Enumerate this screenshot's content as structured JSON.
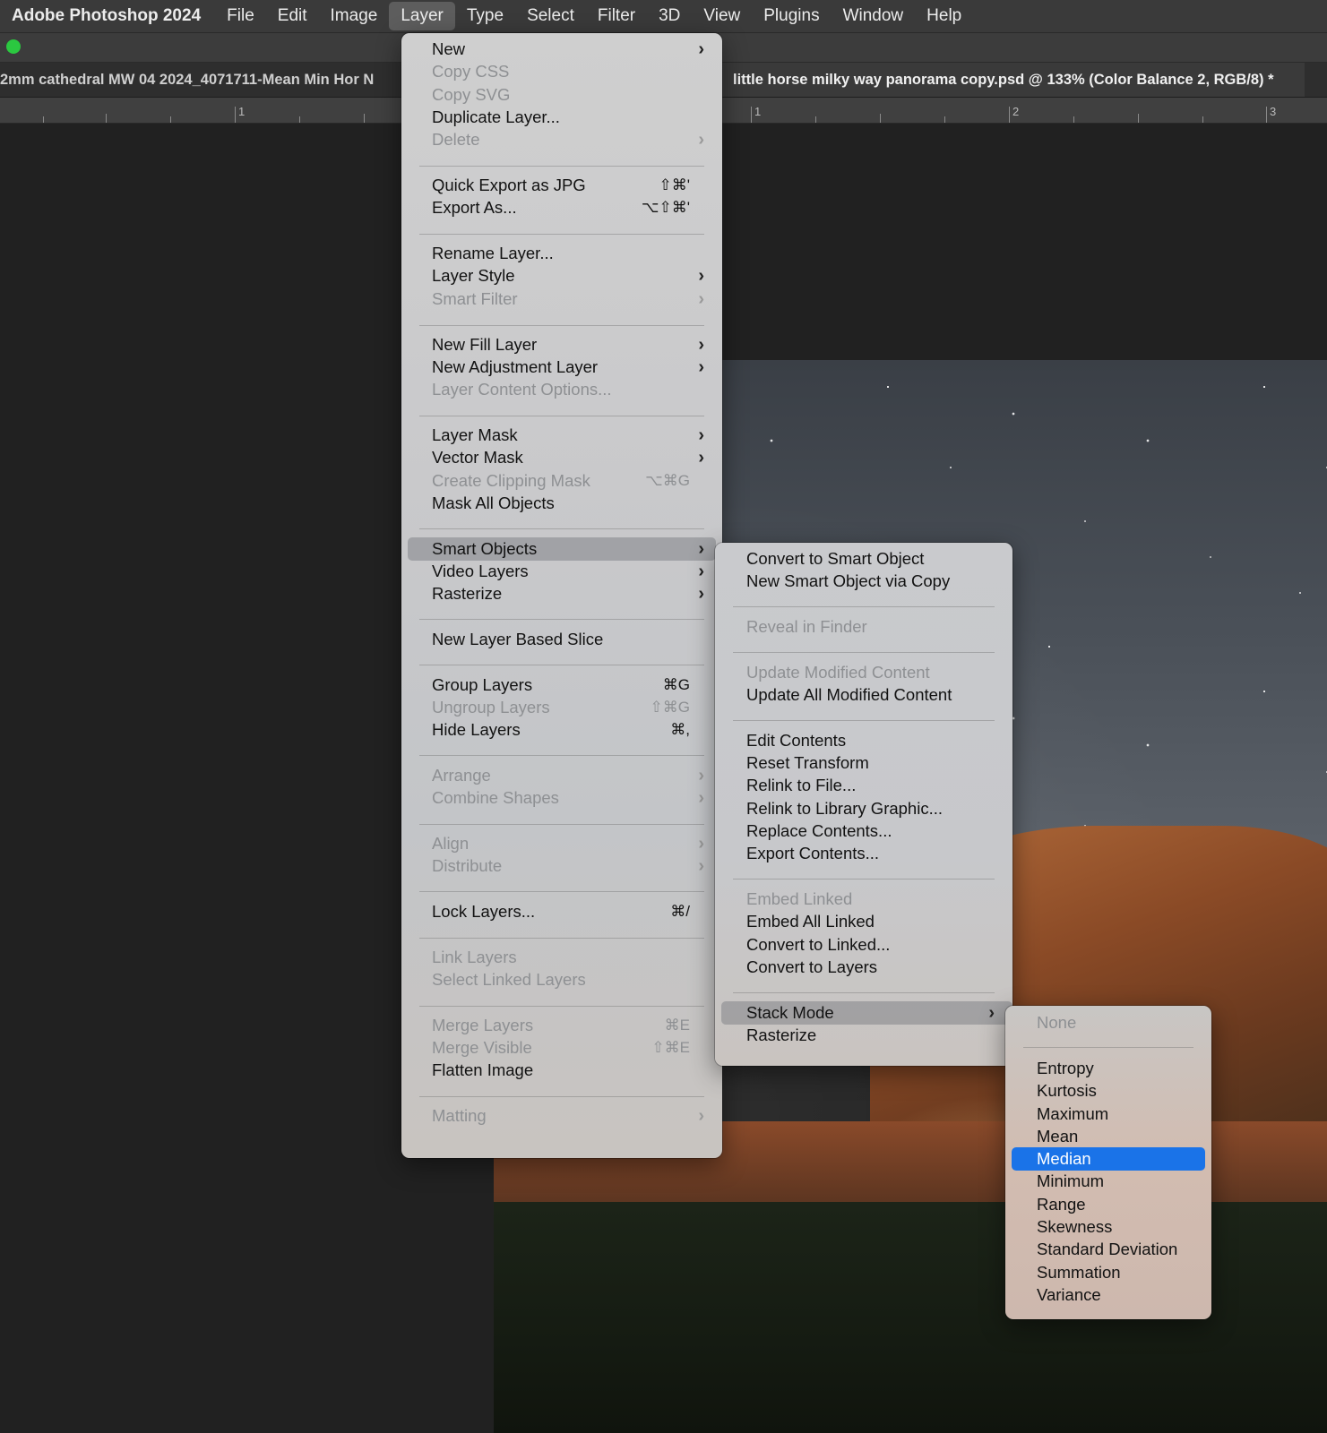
{
  "menubar": {
    "app_name": "Adobe Photoshop 2024",
    "items": [
      "File",
      "Edit",
      "Image",
      "Layer",
      "Type",
      "Select",
      "Filter",
      "3D",
      "View",
      "Plugins",
      "Window",
      "Help"
    ]
  },
  "tabs": {
    "inactive": "2mm cathedral MW 04 2024_4071711-Mean Min Hor N",
    "active": "little horse milky way panorama copy.psd @ 133% (Color Balance 2, RGB/8) *"
  },
  "ruler": {
    "marks": [
      "1",
      "1",
      "2",
      "3"
    ]
  },
  "layer_menu": {
    "items": [
      {
        "label": "New",
        "arrow": true
      },
      {
        "label": "Copy CSS",
        "disabled": true
      },
      {
        "label": "Copy SVG",
        "disabled": true
      },
      {
        "label": "Duplicate Layer..."
      },
      {
        "label": "Delete",
        "disabled": true,
        "arrow": true
      },
      {
        "label": "Quick Export as JPG",
        "shortcut": "⇧⌘'"
      },
      {
        "label": "Export As...",
        "shortcut": "⌥⇧⌘'"
      },
      {
        "label": "Rename Layer..."
      },
      {
        "label": "Layer Style",
        "arrow": true
      },
      {
        "label": "Smart Filter",
        "disabled": true,
        "arrow": true
      },
      {
        "label": "New Fill Layer",
        "arrow": true
      },
      {
        "label": "New Adjustment Layer",
        "arrow": true
      },
      {
        "label": "Layer Content Options...",
        "disabled": true
      },
      {
        "label": "Layer Mask",
        "arrow": true
      },
      {
        "label": "Vector Mask",
        "arrow": true
      },
      {
        "label": "Create Clipping Mask",
        "disabled": true,
        "shortcut": "⌥⌘G"
      },
      {
        "label": "Mask All Objects"
      },
      {
        "label": "Smart Objects",
        "arrow": true,
        "highlight": true
      },
      {
        "label": "Video Layers",
        "arrow": true
      },
      {
        "label": "Rasterize",
        "arrow": true
      },
      {
        "label": "New Layer Based Slice"
      },
      {
        "label": "Group Layers",
        "shortcut": "⌘G"
      },
      {
        "label": "Ungroup Layers",
        "disabled": true,
        "shortcut": "⇧⌘G"
      },
      {
        "label": "Hide Layers",
        "shortcut": "⌘,"
      },
      {
        "label": "Arrange",
        "disabled": true,
        "arrow": true
      },
      {
        "label": "Combine Shapes",
        "disabled": true,
        "arrow": true
      },
      {
        "label": "Align",
        "disabled": true,
        "arrow": true
      },
      {
        "label": "Distribute",
        "disabled": true,
        "arrow": true
      },
      {
        "label": "Lock Layers...",
        "shortcut": "⌘/"
      },
      {
        "label": "Link Layers",
        "disabled": true
      },
      {
        "label": "Select Linked Layers",
        "disabled": true
      },
      {
        "label": "Merge Layers",
        "disabled": true,
        "shortcut": "⌘E"
      },
      {
        "label": "Merge Visible",
        "disabled": true,
        "shortcut": "⇧⌘E"
      },
      {
        "label": "Flatten Image"
      },
      {
        "label": "Matting",
        "disabled": true,
        "arrow": true
      }
    ]
  },
  "smart_objects_menu": {
    "items": [
      {
        "label": "Convert to Smart Object"
      },
      {
        "label": "New Smart Object via Copy"
      },
      {
        "label": "Reveal in Finder",
        "disabled": true
      },
      {
        "label": "Update Modified Content",
        "disabled": true
      },
      {
        "label": "Update All Modified Content"
      },
      {
        "label": "Edit Contents"
      },
      {
        "label": "Reset Transform"
      },
      {
        "label": "Relink to File..."
      },
      {
        "label": "Relink to Library Graphic..."
      },
      {
        "label": "Replace Contents..."
      },
      {
        "label": "Export Contents..."
      },
      {
        "label": "Embed Linked",
        "disabled": true
      },
      {
        "label": "Embed All Linked"
      },
      {
        "label": "Convert to Linked..."
      },
      {
        "label": "Convert to Layers"
      },
      {
        "label": "Stack Mode",
        "arrow": true,
        "highlight": true
      },
      {
        "label": "Rasterize"
      }
    ]
  },
  "stack_mode_menu": {
    "items": [
      {
        "label": "None",
        "disabled": true
      },
      {
        "label": "Entropy"
      },
      {
        "label": "Kurtosis"
      },
      {
        "label": "Maximum"
      },
      {
        "label": "Mean"
      },
      {
        "label": "Median",
        "selected": true
      },
      {
        "label": "Minimum"
      },
      {
        "label": "Range"
      },
      {
        "label": "Skewness"
      },
      {
        "label": "Standard Deviation"
      },
      {
        "label": "Summation"
      },
      {
        "label": "Variance"
      }
    ]
  },
  "colors": {
    "selected": "#1a73e8",
    "status_dot": "#2bc840"
  }
}
